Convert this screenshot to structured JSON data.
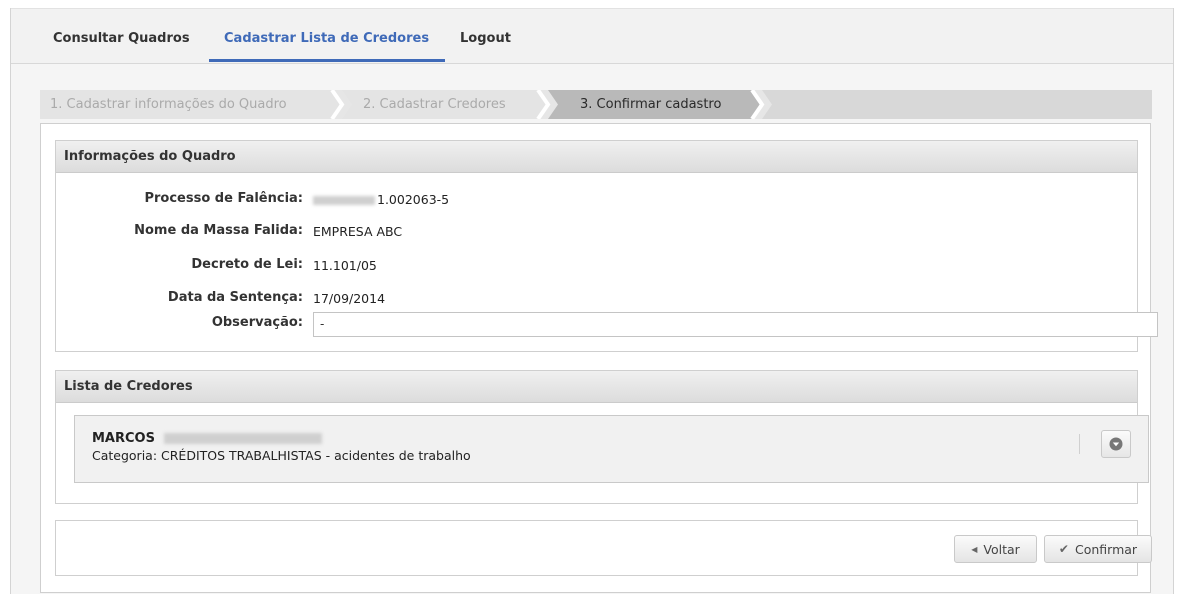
{
  "nav": {
    "items": [
      {
        "label": "Consultar Quadros"
      },
      {
        "label": "Cadastrar Lista de Credores"
      },
      {
        "label": "Logout"
      }
    ]
  },
  "wizard": {
    "steps": [
      {
        "label": "1. Cadastrar informações do Quadro"
      },
      {
        "label": "2. Cadastrar Credores"
      },
      {
        "label": "3. Confirmar cadastro"
      }
    ]
  },
  "quadro": {
    "title": "Informações do Quadro",
    "fields": [
      {
        "label": "Processo de Falência:",
        "value": "1.002063-5"
      },
      {
        "label": "Nome da Massa Falida:",
        "value": "EMPRESA ABC"
      },
      {
        "label": "Decreto de Lei:",
        "value": "11.101/05"
      },
      {
        "label": "Data da Sentença:",
        "value": "17/09/2014"
      },
      {
        "label": "Observação:",
        "value": "-"
      }
    ]
  },
  "credores": {
    "title": "Lista de Credores",
    "items": [
      {
        "name": "MARCOS",
        "category": "Categoria: CRÉDITOS TRABALHISTAS - acidentes de trabalho"
      }
    ]
  },
  "actions": {
    "back_label": "Voltar",
    "confirm_label": "Confirmar"
  },
  "colors": {
    "accent": "#3f6ab8",
    "step_inactive": "#e4e4e4",
    "step_current": "#b7b7b7"
  }
}
